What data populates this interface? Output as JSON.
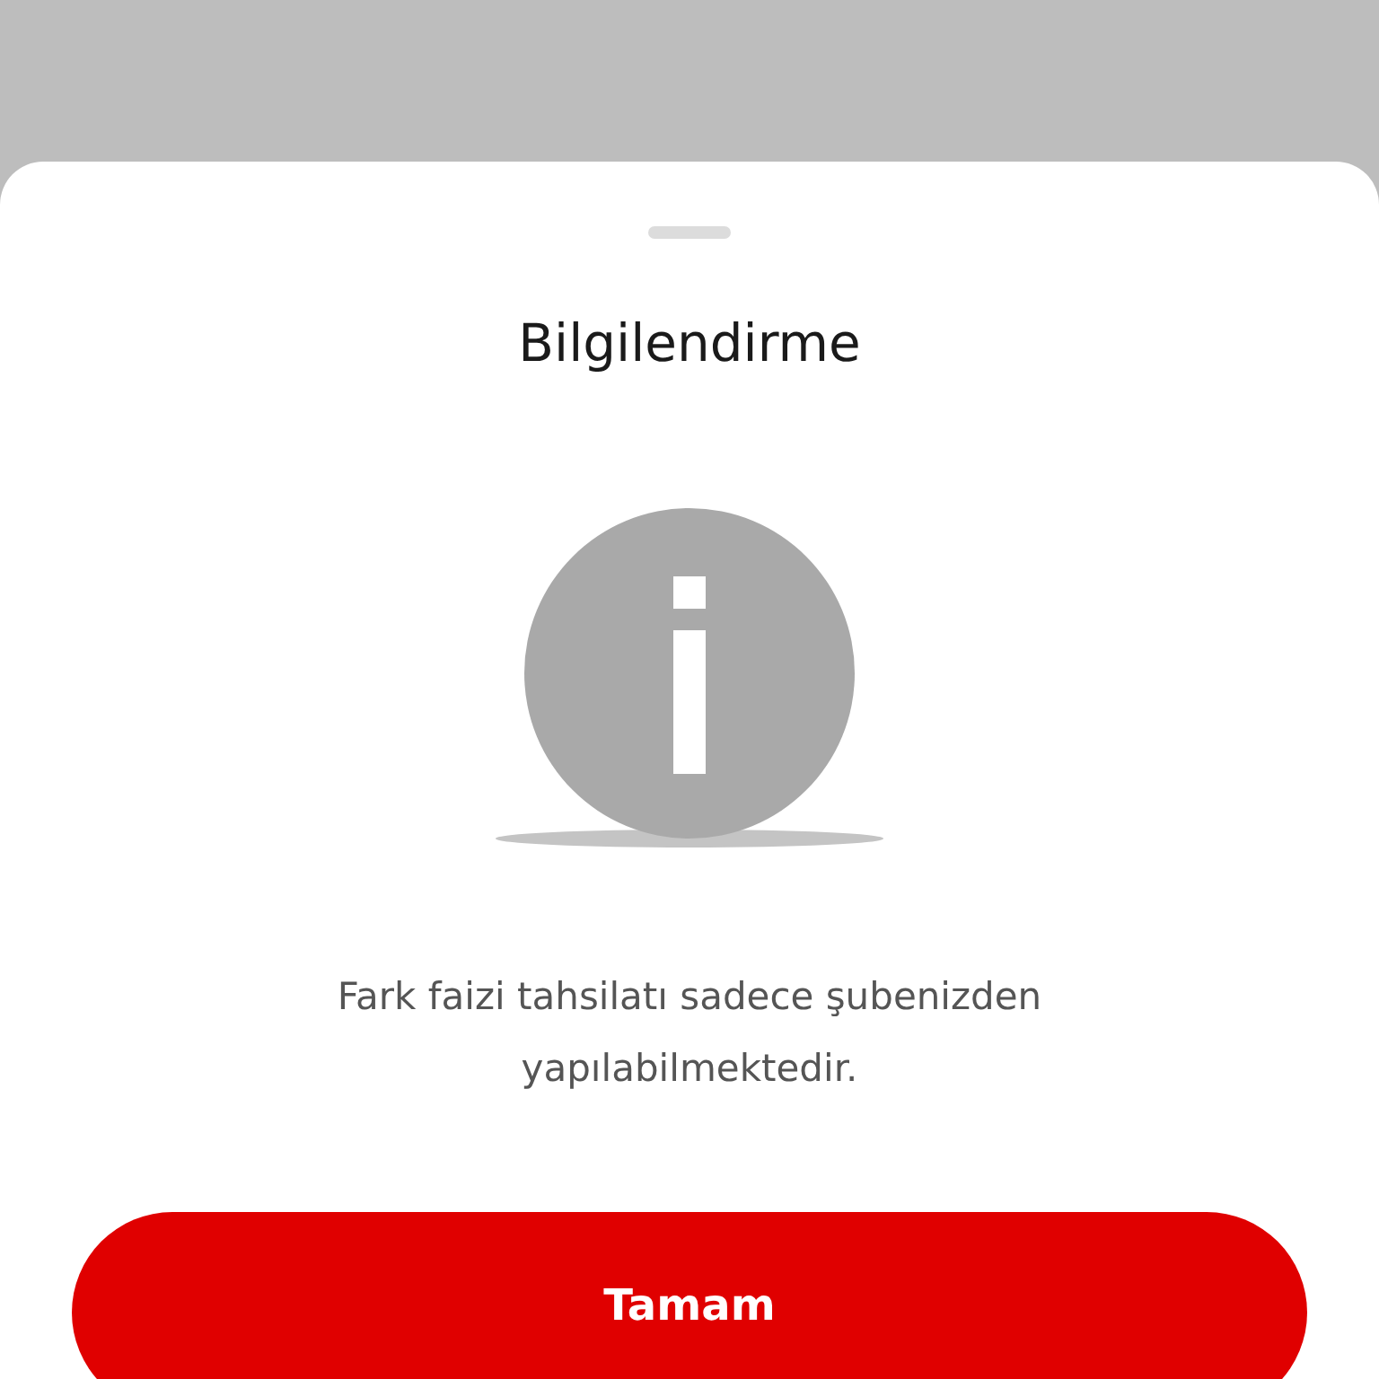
{
  "sheet": {
    "title": "Bilgilendirme",
    "message": "Fark faizi tahsilatı sadece şubenizden yapılabilmektedir.",
    "button": "Tamam"
  }
}
